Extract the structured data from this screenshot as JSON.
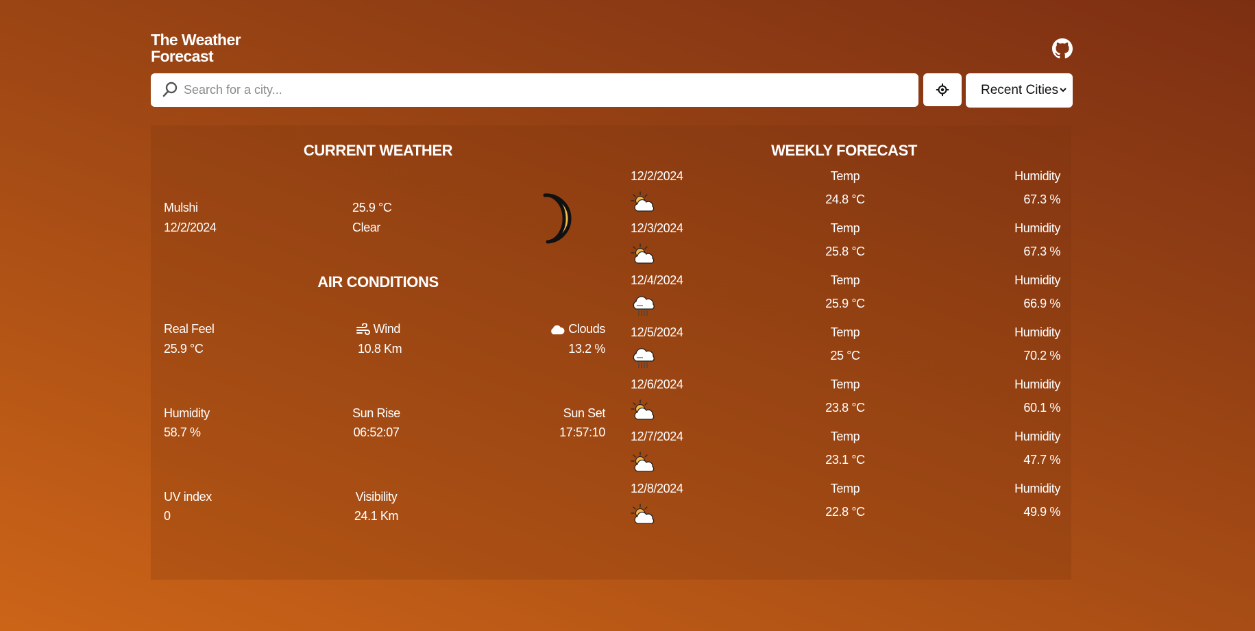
{
  "app": {
    "title": "The Weather Forecast"
  },
  "search": {
    "placeholder": "Search for a city...",
    "value": ""
  },
  "toolbar": {
    "recent_label": "Recent Cities"
  },
  "current": {
    "heading": "CURRENT WEATHER",
    "city": "Mulshi",
    "date": "12/2/2024",
    "temp": "25.9 °C",
    "description": "Clear",
    "icon": "moon-icon"
  },
  "air": {
    "heading": "AIR CONDITIONS",
    "real_feel_label": "Real Feel",
    "real_feel": "25.9 °C",
    "wind_label": "Wind",
    "wind": "10.8 Km",
    "clouds_label": "Clouds",
    "clouds": "13.2 %",
    "humidity_label": "Humidity",
    "humidity": "58.7 %",
    "sunrise_label": "Sun Rise",
    "sunrise": "06:52:07",
    "sunset_label": "Sun Set",
    "sunset": "17:57:10",
    "uv_label": "UV index",
    "uv": "0",
    "visibility_label": "Visibility",
    "visibility": "24.1 Km"
  },
  "weekly": {
    "heading": "WEEKLY FORECAST",
    "rows": [
      {
        "date": "12/2/2024",
        "temp_label": "Temp",
        "temp": "24.8 °C",
        "humidity_label": "Humidity",
        "humidity": "67.3 %",
        "icon": "partly-cloudy-icon"
      },
      {
        "date": "12/3/2024",
        "temp_label": "Temp",
        "temp": "25.8 °C",
        "humidity_label": "Humidity",
        "humidity": "67.3 %",
        "icon": "partly-cloudy-icon"
      },
      {
        "date": "12/4/2024",
        "temp_label": "Temp",
        "temp": "25.9 °C",
        "humidity_label": "Humidity",
        "humidity": "66.9 %",
        "icon": "rain-cloud-icon"
      },
      {
        "date": "12/5/2024",
        "temp_label": "Temp",
        "temp": "25 °C",
        "humidity_label": "Humidity",
        "humidity": "70.2 %",
        "icon": "rain-cloud-icon"
      },
      {
        "date": "12/6/2024",
        "temp_label": "Temp",
        "temp": "23.8 °C",
        "humidity_label": "Humidity",
        "humidity": "60.1 %",
        "icon": "partly-cloudy-icon"
      },
      {
        "date": "12/7/2024",
        "temp_label": "Temp",
        "temp": "23.1 °C",
        "humidity_label": "Humidity",
        "humidity": "47.7 %",
        "icon": "partly-cloudy-icon"
      },
      {
        "date": "12/8/2024",
        "temp_label": "Temp",
        "temp": "22.8 °C",
        "humidity_label": "Humidity",
        "humidity": "49.9 %",
        "icon": "partly-cloudy-icon"
      }
    ]
  },
  "colors": {
    "accent": "#f5b84a",
    "text": "#ffffff"
  }
}
